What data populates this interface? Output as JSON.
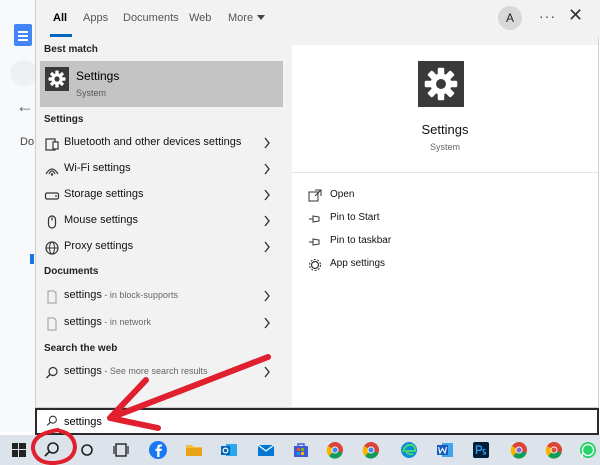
{
  "tabs": [
    {
      "label": "All",
      "active": true
    },
    {
      "label": "Apps"
    },
    {
      "label": "Documents"
    },
    {
      "label": "Web"
    },
    {
      "label": "More"
    }
  ],
  "header": {
    "avatar_initial": "A",
    "more_options": "···",
    "close": "✕"
  },
  "background_app": {
    "text": "Do"
  },
  "best_match": {
    "heading": "Best match",
    "title": "Settings",
    "subtitle": "System",
    "icon": "gear-icon"
  },
  "settings_section": {
    "heading": "Settings",
    "items": [
      {
        "label": "Bluetooth and other devices settings",
        "icon": "bluetooth-device-icon"
      },
      {
        "label": "Wi-Fi settings",
        "icon": "wifi-icon"
      },
      {
        "label": "Storage settings",
        "icon": "storage-icon"
      },
      {
        "label": "Mouse settings",
        "icon": "mouse-icon"
      },
      {
        "label": "Proxy settings",
        "icon": "globe-icon"
      }
    ]
  },
  "documents_section": {
    "heading": "Documents",
    "items": [
      {
        "label": "settings",
        "sub": " - in block-supports",
        "icon": "document-icon"
      },
      {
        "label": "settings",
        "sub": " - in network",
        "icon": "document-icon"
      }
    ]
  },
  "web_section": {
    "heading": "Search the web",
    "items": [
      {
        "label": "settings",
        "sub": " - See more search results",
        "icon": "search-icon"
      }
    ]
  },
  "preview": {
    "title": "Settings",
    "subtitle": "System",
    "actions": [
      {
        "label": "Open",
        "icon": "open-icon"
      },
      {
        "label": "Pin to Start",
        "icon": "pin-icon"
      },
      {
        "label": "Pin to taskbar",
        "icon": "pin-icon"
      },
      {
        "label": "App settings",
        "icon": "gear-icon"
      }
    ]
  },
  "search": {
    "value": "settings"
  },
  "taskbar": {
    "items": [
      "windows-start-icon",
      "search-icon",
      "cortana-icon",
      "task-view-icon",
      "facebook-icon",
      "file-explorer-icon",
      "outlook-icon",
      "mail-icon",
      "store-icon",
      "chrome-icon",
      "edge-icon",
      "word-icon",
      "photoshop-icon",
      "chrome-icon",
      "chrome-icon",
      "whatsapp-icon"
    ]
  },
  "colors": {
    "accent": "#0067c0",
    "annotation": "#e0202e"
  }
}
